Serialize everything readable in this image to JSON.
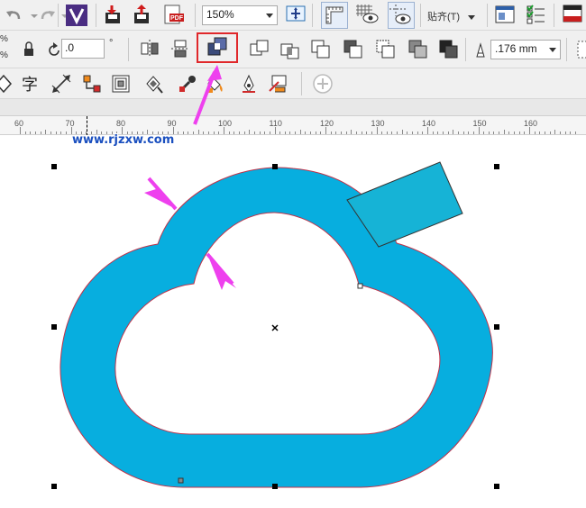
{
  "toolbar_top": {
    "zoom_value": "150%",
    "snap_label": "贴齐(T)"
  },
  "property_bar": {
    "angle_value": ".0",
    "angle_unit": "°",
    "outline_width": ".176 mm",
    "percent_top": "%",
    "percent_bottom": "%"
  },
  "toolbox": {
    "text_tool_label": "字"
  },
  "ruler": {
    "labels": [
      "60",
      "70",
      "80",
      "90",
      "100",
      "110",
      "120",
      "130",
      "140",
      "150",
      "160"
    ]
  },
  "canvas": {
    "watermark": "www.rjzxw.com",
    "shape_fill_color": "#07aedf",
    "rect_fill_color": "#16b3d6",
    "outline_color": "#c0334a",
    "highlight_color": "#e0282b",
    "arrow_color": "#ee40ee"
  }
}
